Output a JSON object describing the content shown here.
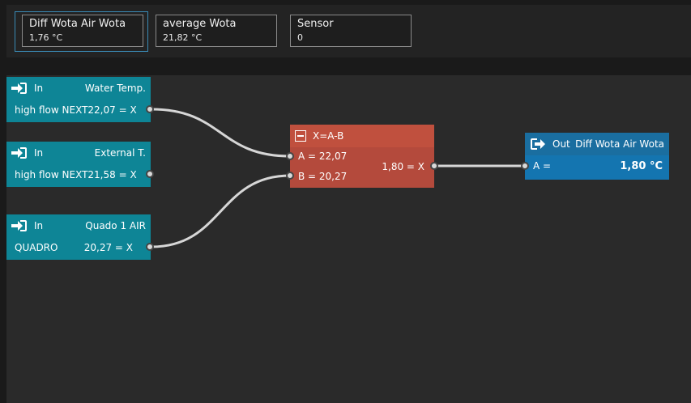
{
  "tiles": [
    {
      "title": "Diff Wota Air Wota",
      "value": "1,76 °C"
    },
    {
      "title": "average Wota",
      "value": "21,82 °C"
    },
    {
      "title": "Sensor",
      "value": "0"
    }
  ],
  "inputs": [
    {
      "label": "In",
      "name": "Water Temp.",
      "source": "high flow NEXT",
      "value": "22,07 = X"
    },
    {
      "label": "In",
      "name": "External T.",
      "source": "high flow NEXT",
      "value": "21,58 = X"
    },
    {
      "label": "In",
      "name": "Quado 1 AIR",
      "source": "QUADRO",
      "value": "20,27 = X"
    }
  ],
  "operator": {
    "formula": "X=A-B",
    "a": "A = 22,07",
    "b": "B = 20,27",
    "result": "1,80 = X"
  },
  "output": {
    "label": "Out",
    "name": "Diff Wota Air Wota",
    "input": "A =",
    "value": "1,80 °C"
  },
  "icons": {
    "input": "sign-in-icon",
    "output": "sign-out-icon",
    "operator": "minus-square-icon"
  }
}
